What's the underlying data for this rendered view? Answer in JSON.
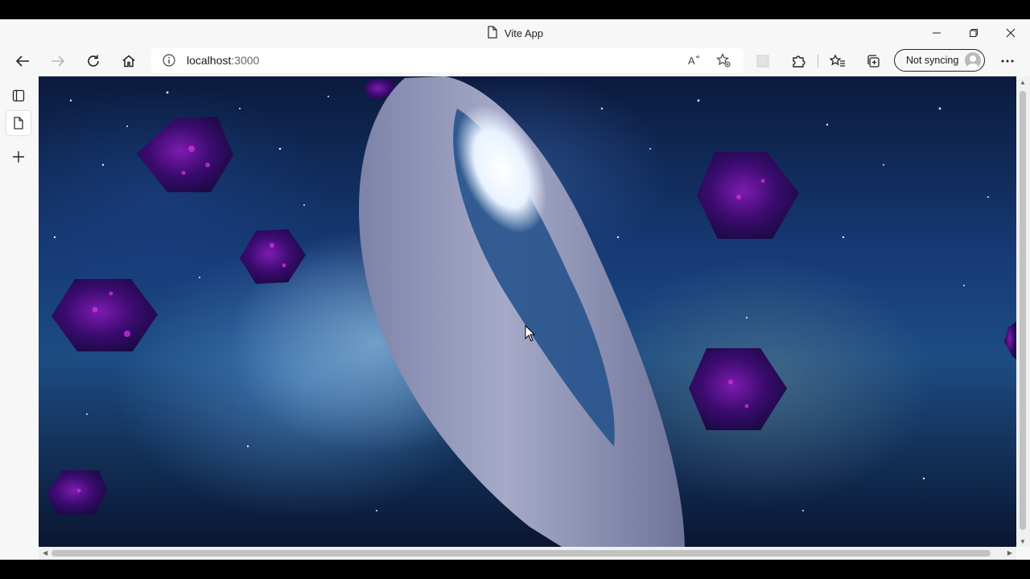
{
  "window": {
    "title": "Vite App",
    "minimize_icon": "minimize-icon",
    "restore_icon": "restore-icon",
    "close_icon": "close-icon"
  },
  "toolbar": {
    "address": {
      "host": "localhost",
      "port": ":3000"
    },
    "sync_label": "Not syncing"
  },
  "colors": {
    "ring": "#8e93b6",
    "gem": "#3a0b6e",
    "gem_glow": "#d42fe6",
    "space": "#173c78"
  }
}
